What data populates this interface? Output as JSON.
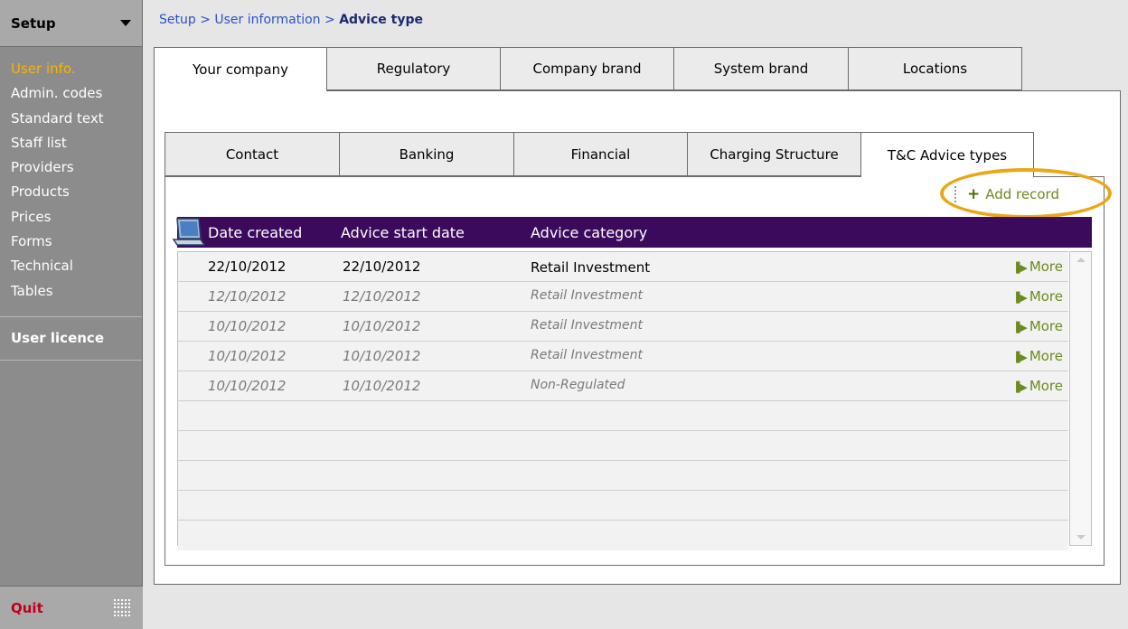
{
  "sidebar": {
    "title": "Setup",
    "items": [
      {
        "label": "User info.",
        "active": true
      },
      {
        "label": "Admin. codes"
      },
      {
        "label": "Standard text"
      },
      {
        "label": "Staff list"
      },
      {
        "label": "Providers"
      },
      {
        "label": "Products"
      },
      {
        "label": "Prices"
      },
      {
        "label": "Forms"
      },
      {
        "label": "Technical"
      },
      {
        "label": "Tables"
      }
    ],
    "licence": "User licence",
    "quit": "Quit"
  },
  "breadcrumb": {
    "part1": "Setup",
    "sep": ">",
    "part2": "User information",
    "current": "Advice type"
  },
  "top_tabs": [
    "Your company",
    "Regulatory",
    "Company brand",
    "System brand",
    "Locations"
  ],
  "sub_tabs": [
    "Contact",
    "Banking",
    "Financial",
    "Charging Structure",
    "T&C Advice types"
  ],
  "add_record": "Add record",
  "table": {
    "headers": [
      "Date created",
      "Advice start date",
      "Advice category"
    ],
    "more_label": "More",
    "rows": [
      {
        "created": "22/10/2012",
        "start": "22/10/2012",
        "category": "Retail Investment"
      },
      {
        "created": "12/10/2012",
        "start": "12/10/2012",
        "category": "Retail Investment"
      },
      {
        "created": "10/10/2012",
        "start": "10/10/2012",
        "category": "Retail Investment"
      },
      {
        "created": "10/10/2012",
        "start": "10/10/2012",
        "category": "Retail Investment"
      },
      {
        "created": "10/10/2012",
        "start": "10/10/2012",
        "category": "Non-Regulated"
      }
    ]
  },
  "colors": {
    "header_bg": "#3b0a5c",
    "active_sidebar": "#f7b500",
    "link_green": "#6b8a1e",
    "highlight_ring": "#e8a818",
    "quit_red": "#c0001a"
  }
}
